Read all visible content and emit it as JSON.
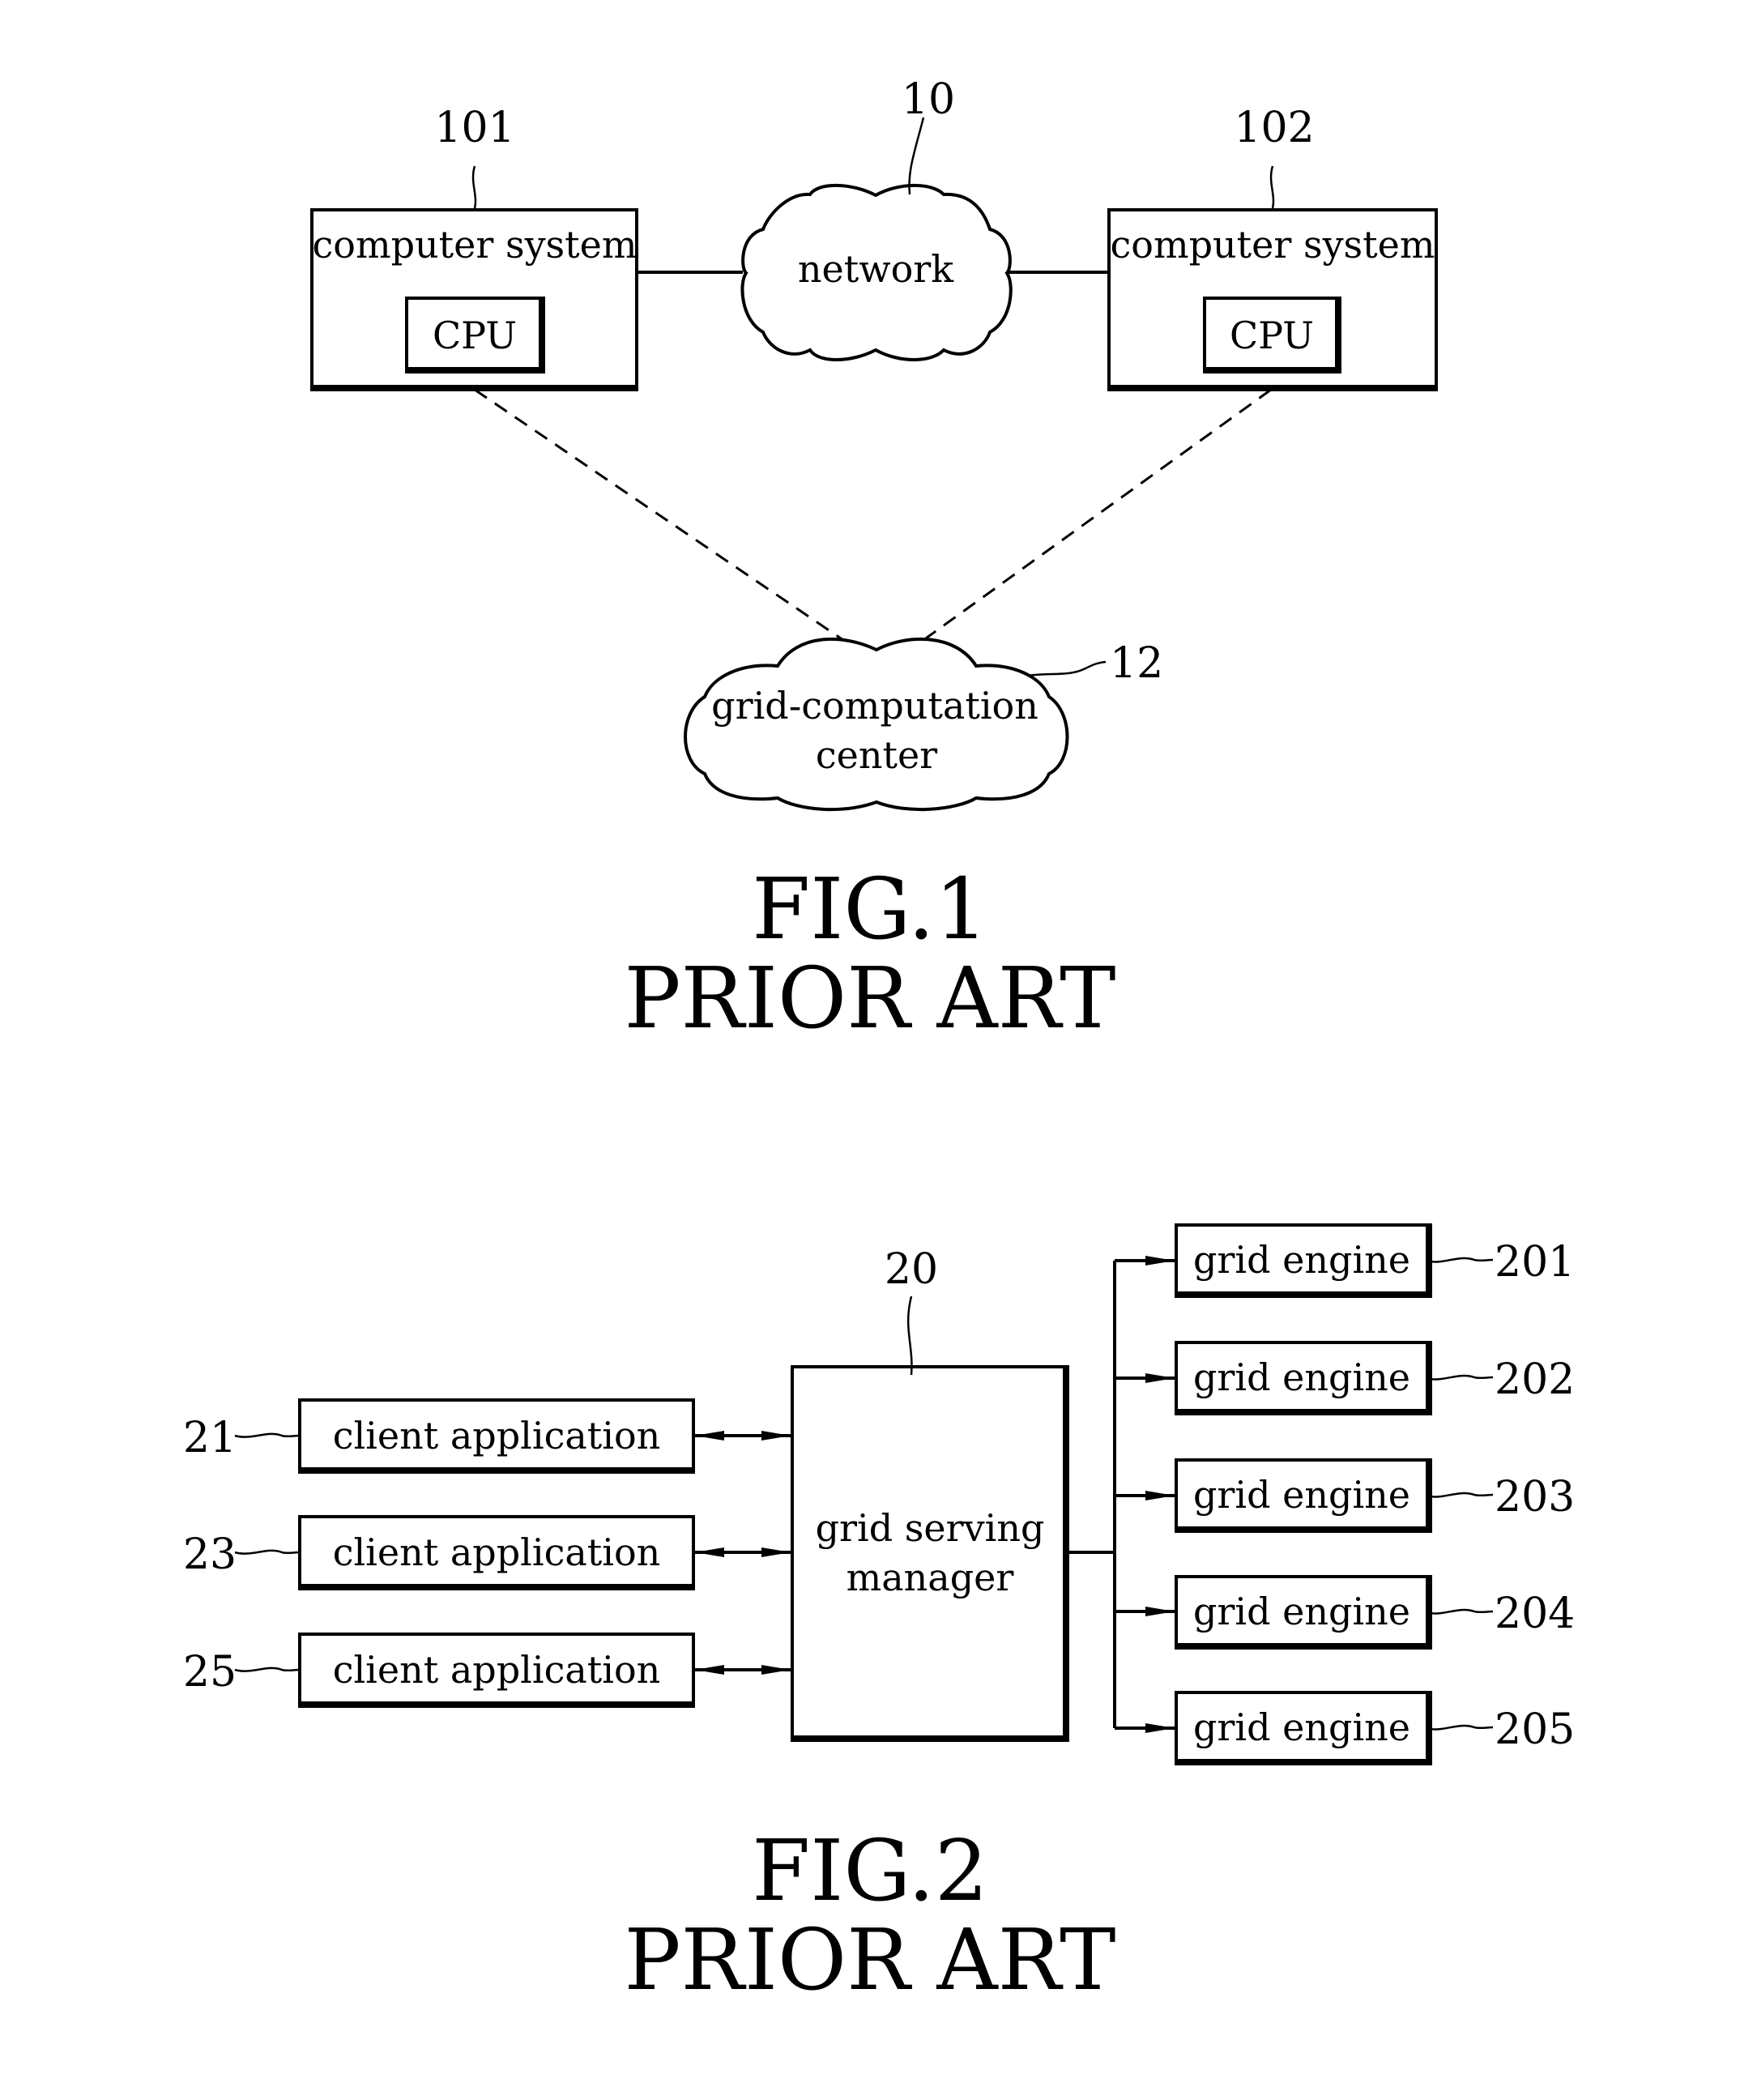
{
  "fig1": {
    "network": {
      "label": "network",
      "ref": "10"
    },
    "systems": [
      {
        "label": "computer system",
        "cpu": "CPU",
        "ref": "101"
      },
      {
        "label": "computer system",
        "cpu": "CPU",
        "ref": "102"
      }
    ],
    "grid_center": {
      "line1": "grid-computation",
      "line2": "center",
      "ref": "12"
    },
    "caption": {
      "title": "FIG.1",
      "subtitle": "PRIOR ART"
    }
  },
  "fig2": {
    "manager": {
      "line1": "grid serving",
      "line2": "manager",
      "ref": "20"
    },
    "clients": [
      {
        "label": "client application",
        "ref": "21"
      },
      {
        "label": "client application",
        "ref": "23"
      },
      {
        "label": "client application",
        "ref": "25"
      }
    ],
    "engines": [
      {
        "label": "grid engine",
        "ref": "201"
      },
      {
        "label": "grid engine",
        "ref": "202"
      },
      {
        "label": "grid engine",
        "ref": "203"
      },
      {
        "label": "grid engine",
        "ref": "204"
      },
      {
        "label": "grid engine",
        "ref": "205"
      }
    ],
    "caption": {
      "title": "FIG.2",
      "subtitle": "PRIOR ART"
    }
  }
}
